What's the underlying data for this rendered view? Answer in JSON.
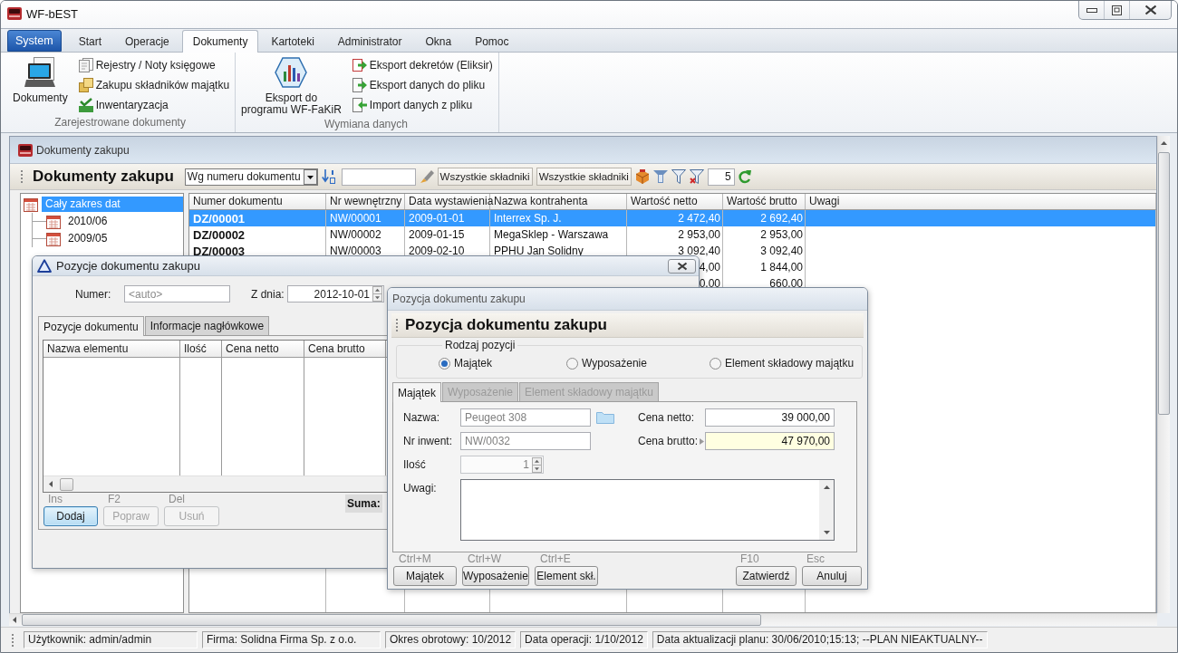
{
  "window": {
    "title": "WF-bEST"
  },
  "ribbon": {
    "tabs": [
      {
        "label": "System",
        "kind": "app",
        "selected": false
      },
      {
        "label": "Start",
        "kind": "tab",
        "selected": false
      },
      {
        "label": "Operacje",
        "kind": "tab",
        "selected": false
      },
      {
        "label": "Dokumenty",
        "kind": "tab",
        "selected": true
      },
      {
        "label": "Kartoteki",
        "kind": "tab",
        "selected": false
      },
      {
        "label": "Administrator",
        "kind": "tab",
        "selected": false
      },
      {
        "label": "Okna",
        "kind": "tab",
        "selected": false
      },
      {
        "label": "Pomoc",
        "kind": "tab",
        "selected": false
      }
    ],
    "groups": [
      {
        "label": "Zarejestrowane dokumenty",
        "large_buttons": [
          {
            "label": "Dokumenty"
          }
        ],
        "small_buttons": [
          {
            "label": "Rejestry / Noty księgowe"
          },
          {
            "label": "Zakupu składników majątku"
          },
          {
            "label": "Inwentaryzacja"
          }
        ]
      },
      {
        "label": "Wymiana danych",
        "large_buttons": [
          {
            "label": "Eksport do\nprogramu WF-FaKiR"
          }
        ],
        "small_buttons": [
          {
            "label": "Eksport dekretów (Eliksir)"
          },
          {
            "label": "Eksport danych do pliku"
          },
          {
            "label": "Import danych z pliku"
          }
        ]
      }
    ]
  },
  "document_window": {
    "title": "Dokumenty zakupu",
    "toolbar": {
      "heading": "Dokumenty zakupu",
      "sort_by": "Wg numeru dokumentu",
      "filter_buttons": [
        {
          "label": "Wszystkie składniki"
        },
        {
          "label": "Wszystkie składniki"
        }
      ],
      "page_size": "5"
    },
    "date_tree": [
      {
        "label": "Cały zakres dat",
        "selected": true,
        "children": [
          {
            "label": "2010/06",
            "selected": false
          },
          {
            "label": "2009/05",
            "selected": false
          }
        ]
      }
    ],
    "table": {
      "columns": [
        "Numer dokumentu",
        "Nr wewnętrzny",
        "Data wystawienia",
        "Nazwa kontrahenta",
        "Wartość netto",
        "Wartość brutto",
        "Uwagi"
      ],
      "rows": [
        {
          "number": "DZ/00001",
          "internal_number": "NW/00001",
          "issue_date": "2009-01-01",
          "contractor": "Interrex Sp. J.",
          "net_value": "2 472,40",
          "gross_value": "2 692,40",
          "selected": true
        },
        {
          "number": "DZ/00002",
          "internal_number": "NW/00002",
          "issue_date": "2009-01-15",
          "contractor": "MegaSklep - Warszawa",
          "net_value": "2 953,00",
          "gross_value": "2 953,00",
          "selected": false
        },
        {
          "number": "DZ/00003",
          "internal_number": "NW/00003",
          "issue_date": "2009-02-10",
          "contractor": "PPHU Jan Solidny",
          "net_value": "3 092,40",
          "gross_value": "3 092,40",
          "selected": false
        },
        {
          "net_value": "4,00",
          "gross_value": "1 844,00",
          "selected": false
        },
        {
          "net_value": "0,00",
          "gross_value": "660,00",
          "selected": false
        }
      ]
    }
  },
  "items_dialog": {
    "title": "Pozycje dokumentu zakupu",
    "number": {
      "label": "Numer:",
      "placeholder": "<auto>"
    },
    "date": {
      "label": "Z dnia:",
      "value": "2012-10-01"
    },
    "tabs": [
      {
        "label": "Pozycje dokumentu",
        "selected": true
      },
      {
        "label": "Informacje nagłówkowe",
        "selected": false
      }
    ],
    "grid": {
      "columns": [
        "Nazwa elementu",
        "Ilość",
        "Cena netto",
        "Cena brutto"
      ]
    },
    "actions": [
      {
        "shortcut": "Ins",
        "label": "Dodaj",
        "default": true,
        "disabled": false
      },
      {
        "shortcut": "F2",
        "label": "Popraw",
        "default": false,
        "disabled": true
      },
      {
        "shortcut": "Del",
        "label": "Usuń",
        "default": false,
        "disabled": true
      }
    ],
    "sum_label": "Suma:"
  },
  "item_dialog": {
    "title": "Pozycja dokumentu zakupu",
    "heading": "Pozycja dokumentu zakupu",
    "position_type": {
      "label": "Rodzaj pozycji",
      "options": [
        {
          "label": "Majątek",
          "selected": true
        },
        {
          "label": "Wyposażenie",
          "selected": false
        },
        {
          "label": "Element składowy majątku",
          "selected": false
        }
      ]
    },
    "tabs": [
      {
        "label": "Majątek",
        "selected": true,
        "disabled": false
      },
      {
        "label": "Wyposażenie",
        "selected": false,
        "disabled": true
      },
      {
        "label": "Element składowy majątku",
        "selected": false,
        "disabled": true
      }
    ],
    "fields": [
      {
        "kind": "text",
        "label": "Nazwa:",
        "value": "Peugeot 308",
        "readonly": true,
        "lookup": true
      },
      {
        "kind": "text",
        "label": "Nr inwent:",
        "value": "NW/0032",
        "readonly": true,
        "lookup": false
      },
      {
        "kind": "spin",
        "label": "Ilość",
        "value": "1",
        "readonly": true,
        "lookup": false
      }
    ],
    "price_fields": [
      {
        "label": "Cena netto:",
        "value": "39 000,00",
        "focused": false
      },
      {
        "label": "Cena brutto:",
        "value": "47 970,00",
        "focused": true
      }
    ],
    "notes": {
      "label": "Uwagi:"
    },
    "type_buttons": [
      {
        "shortcut": "Ctrl+M",
        "label": "Majątek"
      },
      {
        "shortcut": "Ctrl+W",
        "label": "Wyposażenie"
      },
      {
        "shortcut": "Ctrl+E",
        "label": "Element skł."
      }
    ],
    "dialog_buttons": [
      {
        "shortcut": "F10",
        "label": "Zatwierdź"
      },
      {
        "shortcut": "Esc",
        "label": "Anuluj"
      }
    ]
  },
  "status_bar": [
    "Użytkownik: admin/admin",
    "Firma: Solidna Firma Sp. z o.o.",
    "Okres obrotowy: 10/2012",
    "Data operacji: 1/10/2012",
    "Data aktualizacji planu: 30/06/2010;15:13; --PLAN NIEAKTUALNY--"
  ]
}
